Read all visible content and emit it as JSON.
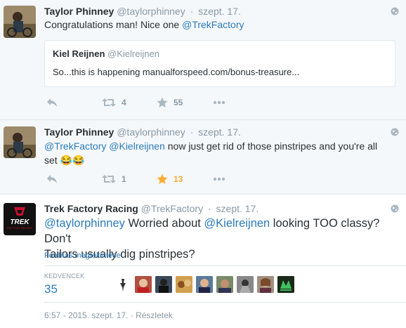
{
  "tweets": [
    {
      "name": "Taylor Phinney",
      "handle": "@taylorphinney",
      "time": "szept. 17.",
      "text_plain": "Congratulations man! Nice one ",
      "text_link": "@TrekFactory",
      "quote": {
        "name": "Kiel Reijnen",
        "handle": "@Kielreijnen",
        "text": "So...this is happening manualforspeed.com/bonus-treasure..."
      },
      "retweets": "4",
      "favorites": "55"
    },
    {
      "name": "Taylor Phinney",
      "handle": "@taylorphinney",
      "time": "szept. 17.",
      "text_link1": "@TrekFactory",
      "text_link2": "@Kielreijnen",
      "text_plain1": " now just get rid of those pinstripes and you're all",
      "text_plain2": "set 😂😂",
      "retweets": "1",
      "favorites": "13"
    },
    {
      "name": "Trek Factory Racing",
      "handle": "@TrekFactory",
      "time": "szept. 17.",
      "text_link1": "@taylorphinney",
      "text_plain1": " Worried about ",
      "text_link2": "@Kielreijnen",
      "text_plain2": " looking TOO classy? Don't",
      "text_line2": "Tailors usually dig pinstripes?",
      "translate": "Fordítás megtekintése",
      "fav_label": "KEDVENCEK",
      "fav_count": "35",
      "footer_time": "6:57 - 2015. szept. 17.",
      "footer_sep": " · ",
      "footer_details": "Részletek",
      "avatar_text": "TREK",
      "avatar_subtext": "FACTORY RACING"
    }
  ],
  "colors": {
    "link": "#2b7bb9",
    "muted": "#8899a6",
    "favorite_active": "#ffac33",
    "background_alt": "#f5f8fa"
  },
  "icons": [
    "globe-icon",
    "reply-icon",
    "retweet-icon",
    "star-icon",
    "more-icon"
  ]
}
